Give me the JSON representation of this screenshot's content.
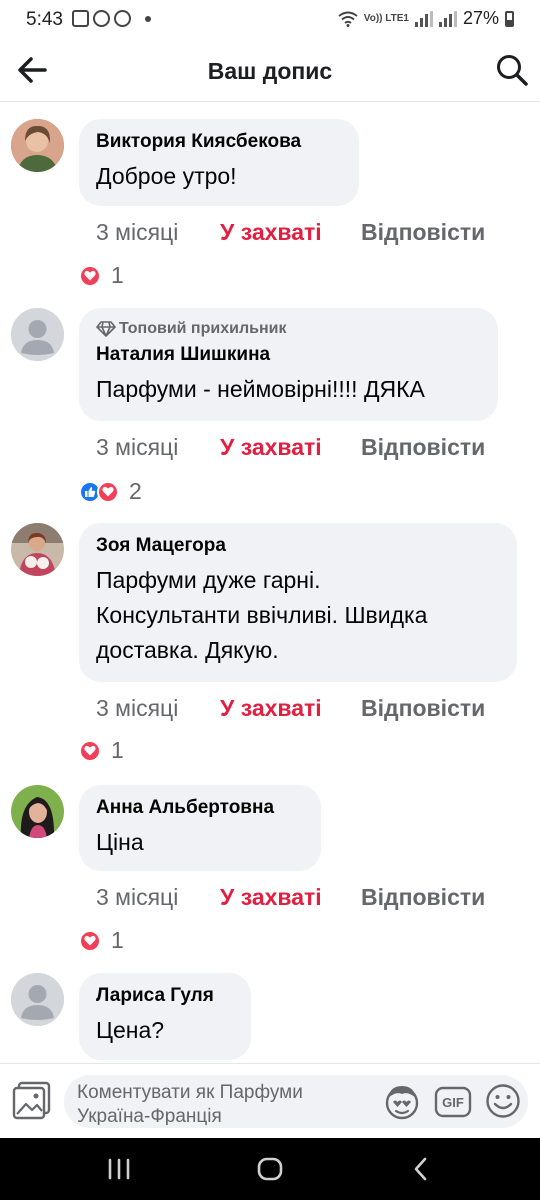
{
  "status_bar": {
    "time": "5:43",
    "network_label": "Vo)) LTE1",
    "battery": "27%",
    "icons": [
      "image-icon",
      "viber-icon",
      "viber-icon",
      "wifi-icon",
      "signal-icon",
      "battery-icon"
    ]
  },
  "header": {
    "title": "Ваш допис",
    "back_icon": "arrow-left-icon",
    "search_icon": "search-icon"
  },
  "comments": [
    {
      "author": "Виктория Киясбекова",
      "text": [
        "Доброе утро!"
      ],
      "badge": "",
      "time": "3 місяці",
      "like_label": "У захваті",
      "reply_label": "Відповісти",
      "reactions": [
        "love"
      ],
      "reaction_count": "1"
    },
    {
      "author": "Наталия Шишкина",
      "text": [
        "Парфуми - неймовірні!!!! ДЯКА"
      ],
      "badge": "Топовий прихильник",
      "time": "3 місяці",
      "like_label": "У захваті",
      "reply_label": "Відповісти",
      "reactions": [
        "like",
        "love"
      ],
      "reaction_count": "2"
    },
    {
      "author": "Зоя Мацегора",
      "text": [
        "Парфуми дуже гарні.",
        "Консультанти ввічливі. Швидка",
        "доставка. Дякую."
      ],
      "badge": "",
      "time": "3 місяці",
      "like_label": "У захваті",
      "reply_label": "Відповісти",
      "reactions": [
        "love"
      ],
      "reaction_count": "1"
    },
    {
      "author": "Анна Альбертовна",
      "text": [
        "Ціна"
      ],
      "badge": "",
      "time": "3 місяці",
      "like_label": "У захваті",
      "reply_label": "Відповісти",
      "reactions": [
        "love"
      ],
      "reaction_count": "1"
    },
    {
      "author": "Лариса Гуля",
      "text": [
        "Цена?"
      ],
      "badge": ""
    }
  ],
  "composer": {
    "placeholder_line1": "Коментувати як Парфуми",
    "placeholder_line2": "Україна-Франція",
    "icons": [
      "photo-icon",
      "avatar-sticker-icon",
      "gif-icon",
      "emoji-icon"
    ]
  },
  "colors": {
    "like_red": "#e41e3f",
    "secondary_text": "#65676b",
    "bubble_bg": "#f0f2f5",
    "love_reaction": "#f33e58",
    "like_reaction": "#1877f2"
  },
  "nav_bar": {
    "icons": [
      "recent-apps-icon",
      "home-icon",
      "back-icon"
    ]
  }
}
